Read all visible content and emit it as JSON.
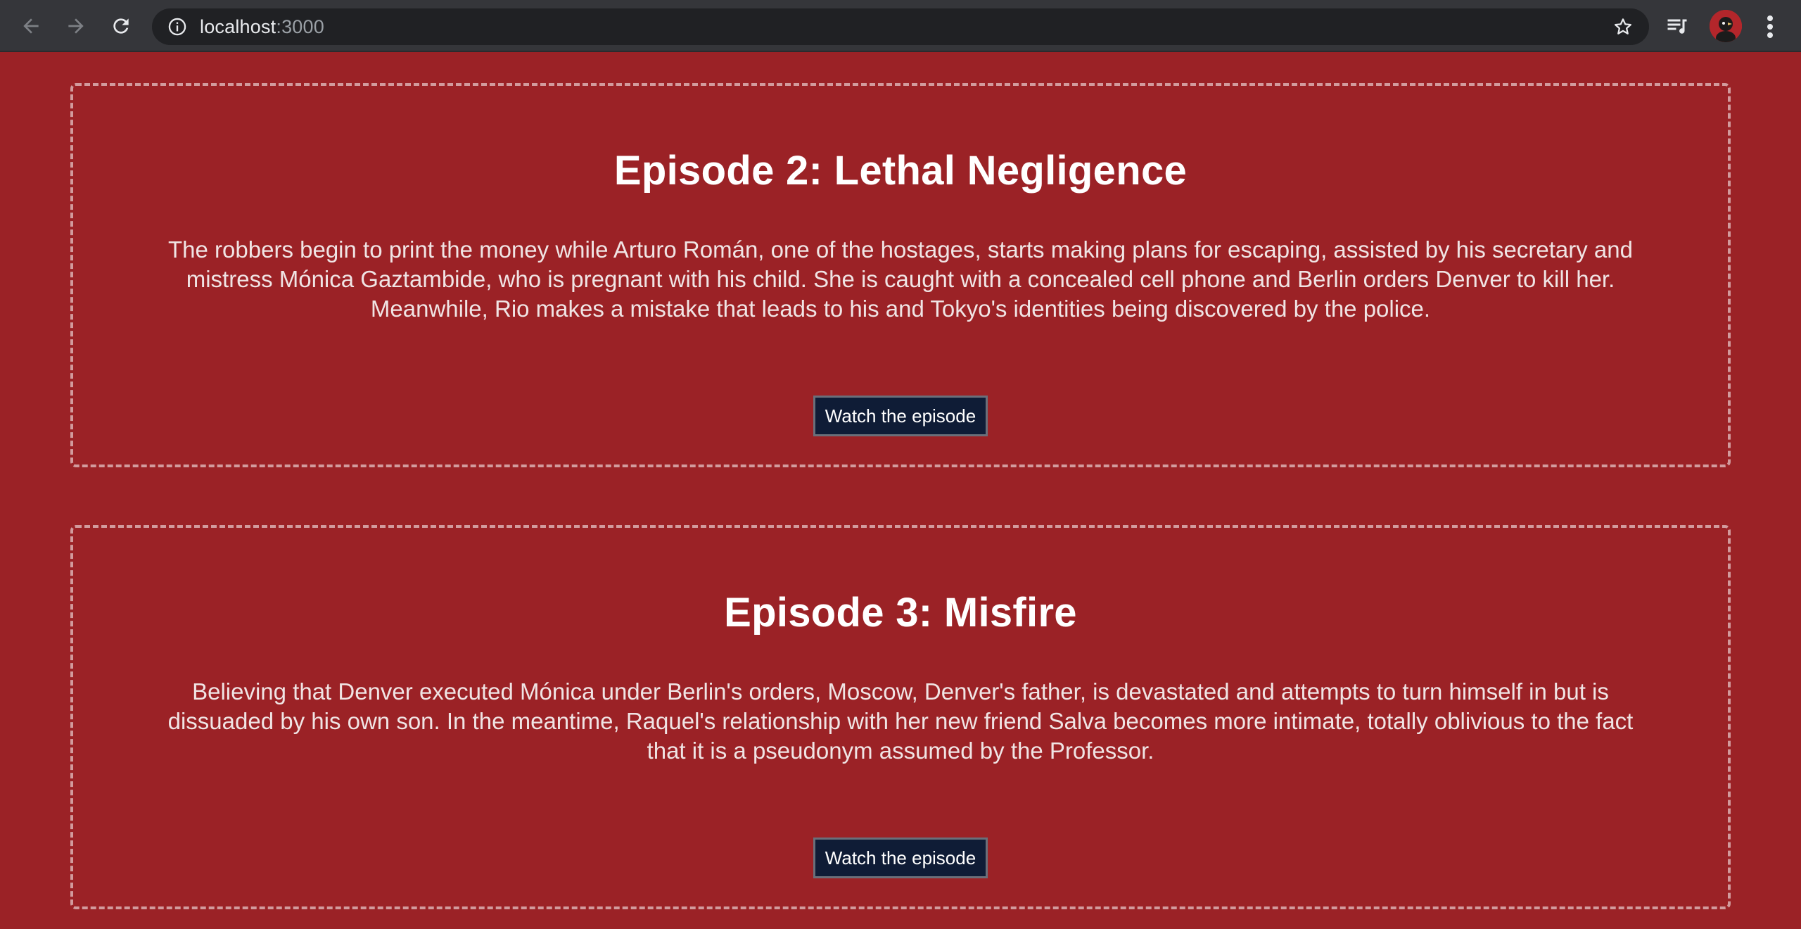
{
  "browser": {
    "url_host": "localhost",
    "url_port": ":3000",
    "icons": {
      "back": "arrow-left-icon",
      "forward": "arrow-right-icon",
      "reload": "reload-icon",
      "info": "info-icon",
      "bookmark": "star-icon",
      "media": "media-queue-icon",
      "menu": "kebab-menu-icon"
    }
  },
  "colors": {
    "page_background": "#9b2226",
    "button_background": "#0f1c36",
    "card_border": "#e6b6b6"
  },
  "episodes": [
    {
      "title": "Episode 2: Lethal Negligence",
      "description": "The robbers begin to print the money while Arturo Román, one of the hostages, starts making plans for escaping, assisted by his secretary and mistress Mónica Gaztambide, who is pregnant with his child. She is caught with a concealed cell phone and Berlin orders Denver to kill her. Meanwhile, Rio makes a mistake that leads to his and Tokyo's identities being discovered by the police.",
      "button_label": "Watch the episode"
    },
    {
      "title": "Episode 3: Misfire",
      "description": "Believing that Denver executed Mónica under Berlin's orders, Moscow, Denver's father, is devastated and attempts to turn himself in but is dissuaded by his own son. In the meantime, Raquel's relationship with her new friend Salva becomes more intimate, totally oblivious to the fact that it is a pseudonym assumed by the Professor.",
      "button_label": "Watch the episode"
    }
  ]
}
